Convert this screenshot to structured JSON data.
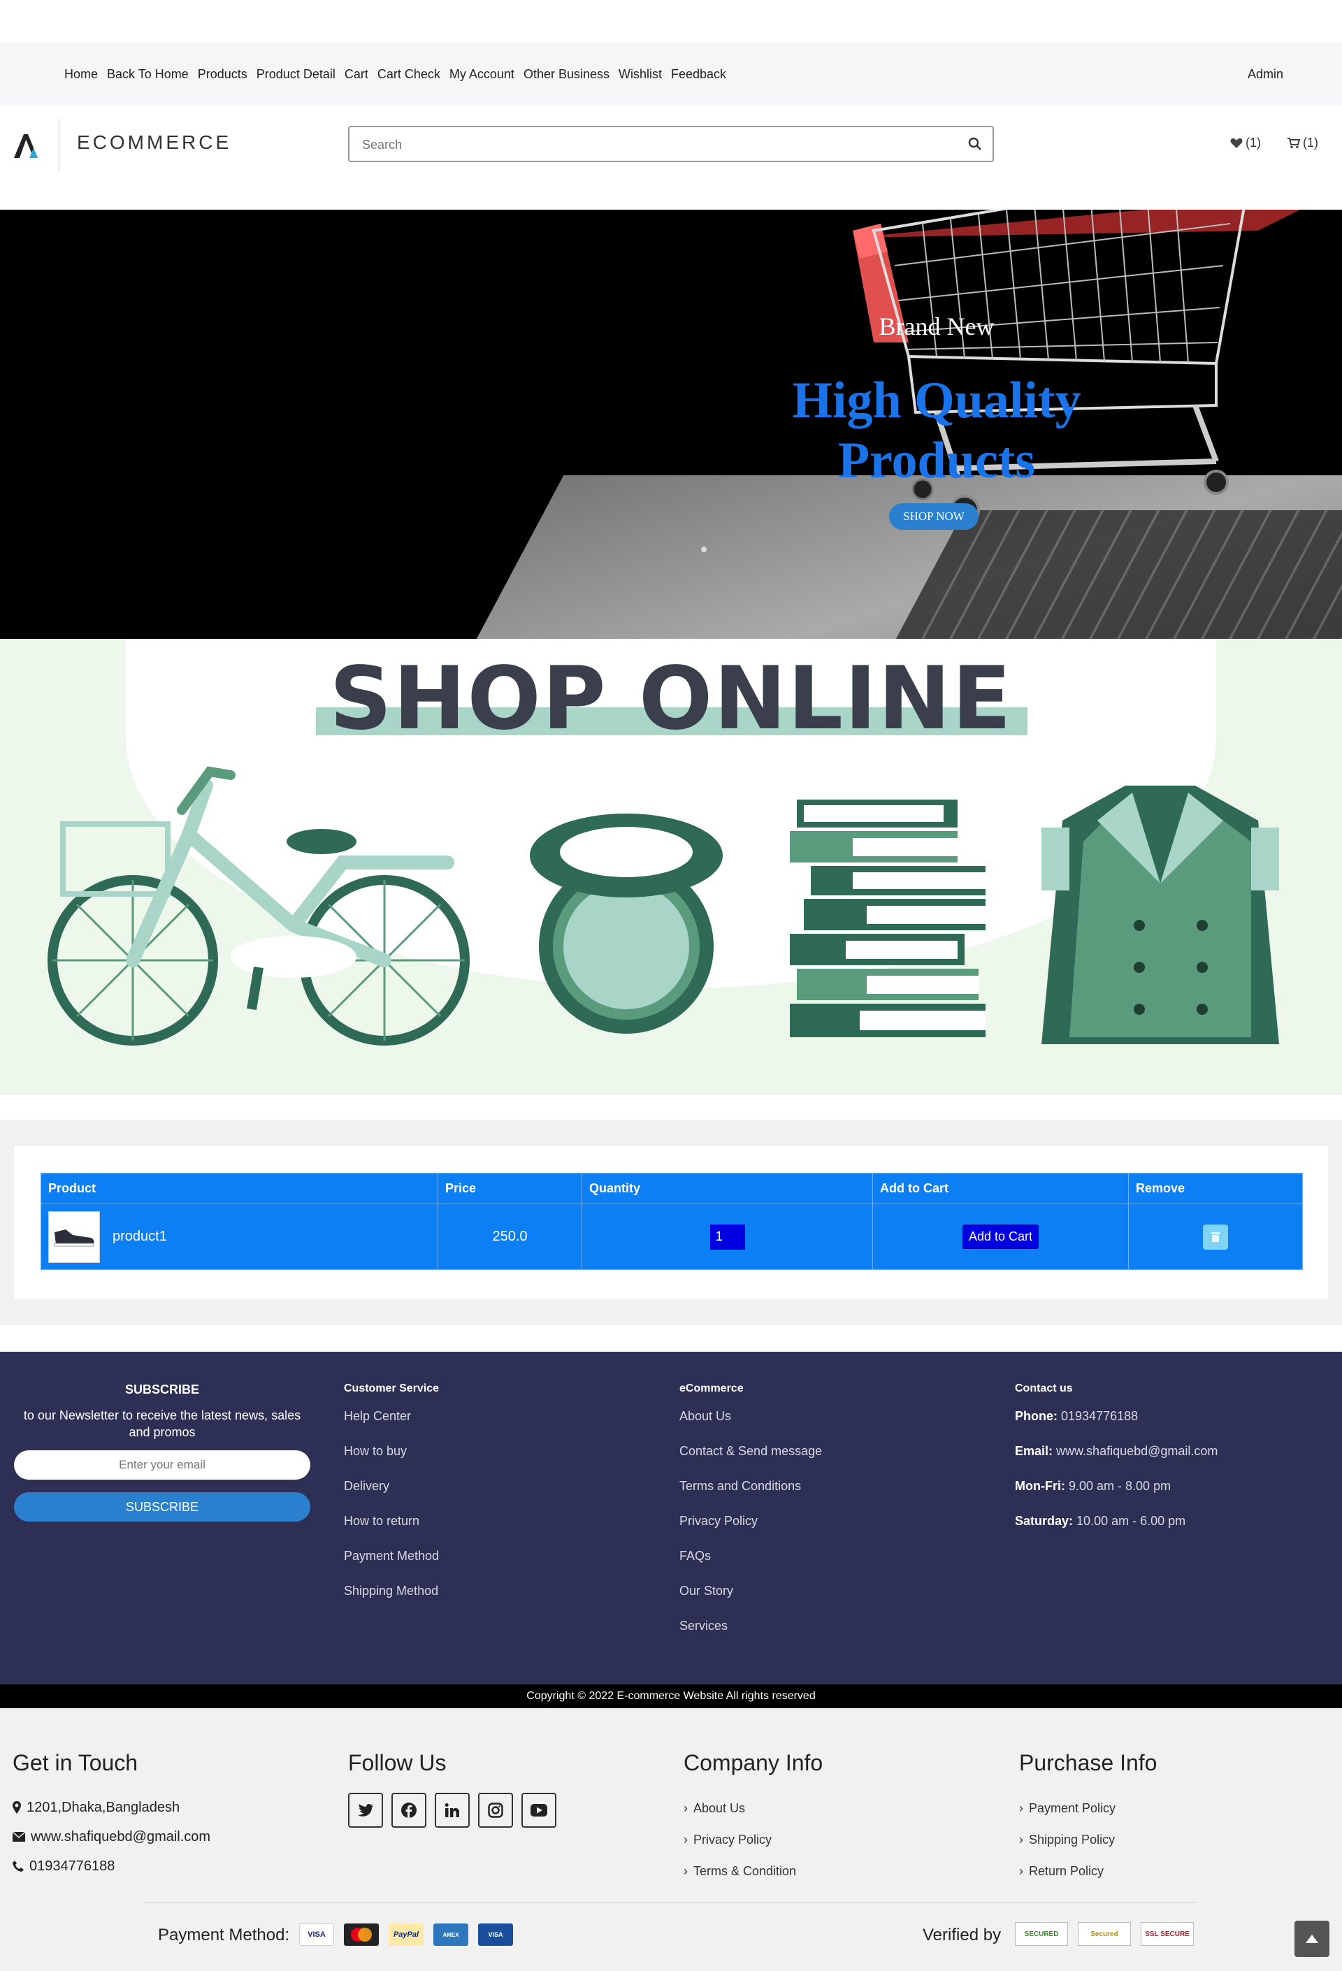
{
  "nav": {
    "items": [
      "Home",
      "Back To Home",
      "Products",
      "Product Detail",
      "Cart",
      "Cart Check",
      "My Account",
      "Other Business",
      "Wishlist",
      "Feedback"
    ],
    "admin": "Admin"
  },
  "header": {
    "logo_text": "ECOMMERCE",
    "search_placeholder": "Search",
    "wishlist_count": "(1)",
    "cart_count": "(1)"
  },
  "hero": {
    "subtitle": "Brand New",
    "headline_line1": "High Quality",
    "headline_line2": "Products",
    "cta": "SHOP NOW"
  },
  "banner": {
    "title": "SHOP ONLINE"
  },
  "cart_table": {
    "headers": [
      "Product",
      "Price",
      "Quantity",
      "Add to Cart",
      "Remove"
    ],
    "rows": [
      {
        "product": "product1",
        "price": "250.0",
        "quantity": "1",
        "add_label": "Add to Cart"
      }
    ]
  },
  "footer": {
    "subscribe": {
      "title": "SUBSCRIBE",
      "text": "to our Newsletter to receive the latest news, sales and promos",
      "placeholder": "Enter your email",
      "button": "SUBSCRIBE"
    },
    "customer_service": {
      "title": "Customer Service",
      "items": [
        "Help Center",
        "How to buy",
        "Delivery",
        "How to return",
        "Payment Method",
        "Shipping Method"
      ]
    },
    "ecommerce": {
      "title": "eCommerce",
      "items": [
        "About Us",
        "Contact & Send message",
        "Terms and Conditions",
        "Privacy Policy",
        "FAQs",
        "Our Story",
        "Services"
      ]
    },
    "contact": {
      "title": "Contact us",
      "items": [
        {
          "label": "Phone:",
          "value": "01934776188"
        },
        {
          "label": "Email:",
          "value": "www.shafiquebd@gmail.com"
        },
        {
          "label": "Mon-Fri:",
          "value": "9.00 am - 8.00 pm"
        },
        {
          "label": "Saturday:",
          "value": "10.00 am - 6.00 pm"
        }
      ]
    },
    "copyright": "Copyright © 2022 E-commerce Website All rights reserved"
  },
  "footer_light": {
    "get_in_touch": {
      "title": "Get in Touch",
      "address": "1201,Dhaka,Bangladesh",
      "email": "www.shafiquebd@gmail.com",
      "phone": "01934776188"
    },
    "follow_us": {
      "title": "Follow Us",
      "icons": [
        "twitter-icon",
        "facebook-icon",
        "linkedin-icon",
        "instagram-icon",
        "youtube-icon"
      ]
    },
    "company_info": {
      "title": "Company Info",
      "items": [
        "About Us",
        "Privacy Policy",
        "Terms & Condition"
      ]
    },
    "purchase_info": {
      "title": "Purchase Info",
      "items": [
        "Payment Policy",
        "Shipping Policy",
        "Return Policy"
      ]
    },
    "payment_label": "Payment Method:",
    "payment_cards": [
      "VISA",
      "MasterCard",
      "PayPal",
      "American Express",
      "VISA Electron"
    ],
    "verified_label": "Verified by",
    "verify_badges": [
      "SECURED",
      "Secured",
      "SSL SECURE"
    ]
  },
  "colors": {
    "accent": "#0d7ff5",
    "footer_bg": "#2e2f54",
    "hero_headline": "#1a73e8",
    "banner_green": "#edf7ec"
  }
}
